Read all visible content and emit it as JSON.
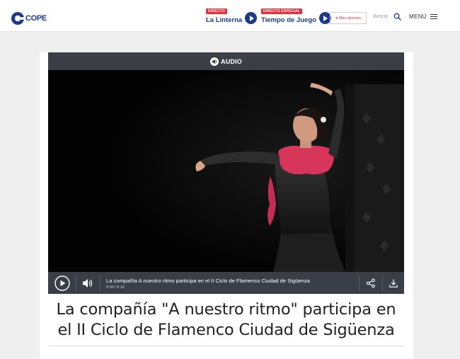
{
  "brand": {
    "logo_text": "COPE",
    "color": "#1b3a8c",
    "accent": "#e3303e"
  },
  "header": {
    "live1": {
      "badge": "DIRECTO",
      "title": "La Linterna"
    },
    "live2": {
      "badge": "DIRECTO ESPECIAL",
      "title": "Tiempo de Juego"
    },
    "more_live": "● Más directos",
    "search_placeholder": "Buscar",
    "menu_label": "MENÚ"
  },
  "player": {
    "type_label": "AUDIO",
    "track_title": "La compañía A nuestro ritmo participa en el II Ciclo de Flamenco Ciudad de Sigüenza",
    "time": "0:00 / 6:12",
    "icons": [
      "play-icon",
      "volume-icon",
      "share-icon",
      "download-icon"
    ]
  },
  "article": {
    "headline": "La compañía \"A nuestro ritmo\" participa en el II Ciclo de Flamenco Ciudad de Sigüenza"
  }
}
